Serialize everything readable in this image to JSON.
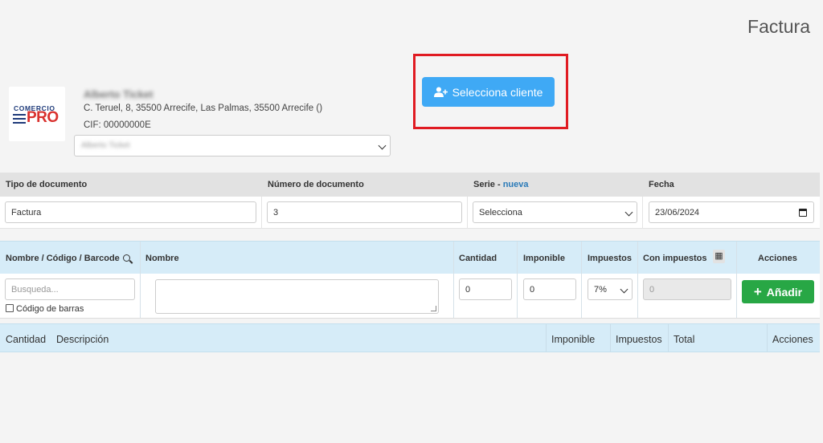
{
  "page": {
    "title": "Factura"
  },
  "company": {
    "logo_top": "COMERCIO",
    "logo_bottom": "PRO",
    "name": "Alberto Ticket",
    "address": "C. Teruel, 8, 35500 Arrecife, Las Palmas, 35500 Arrecife ()",
    "cif": "CIF: 00000000E",
    "selected": "Alberto Ticket"
  },
  "client_button": {
    "label": "Selecciona cliente",
    "color": "#3fa9f5"
  },
  "document": {
    "headers": {
      "type": "Tipo de documento",
      "number": "Número de documento",
      "series": "Serie",
      "series_sep": " - ",
      "series_new": "nueva",
      "date": "Fecha"
    },
    "type_value": "Factura",
    "number_value": "3",
    "series_value": "Selecciona",
    "date_value": "23/06/2024"
  },
  "items": {
    "headers": {
      "code": "Nombre / Código / Barcode",
      "name": "Nombre",
      "quantity": "Cantidad",
      "taxable": "Imponible",
      "taxes": "Impuestos",
      "with_taxes": "Con impuestos",
      "actions": "Acciones"
    },
    "search_placeholder": "Busqueda...",
    "barcode_label": "Código de barras",
    "quantity_value": "0",
    "taxable_value": "0",
    "tax_value": "7%",
    "with_taxes_value": "0",
    "add_label": "Añadir",
    "add_color": "#28a745"
  },
  "lines": {
    "headers": {
      "quantity": "Cantidad",
      "description": "Descripción",
      "taxable": "Imponible",
      "taxes": "Impuestos",
      "total": "Total",
      "actions": "Acciones"
    }
  }
}
